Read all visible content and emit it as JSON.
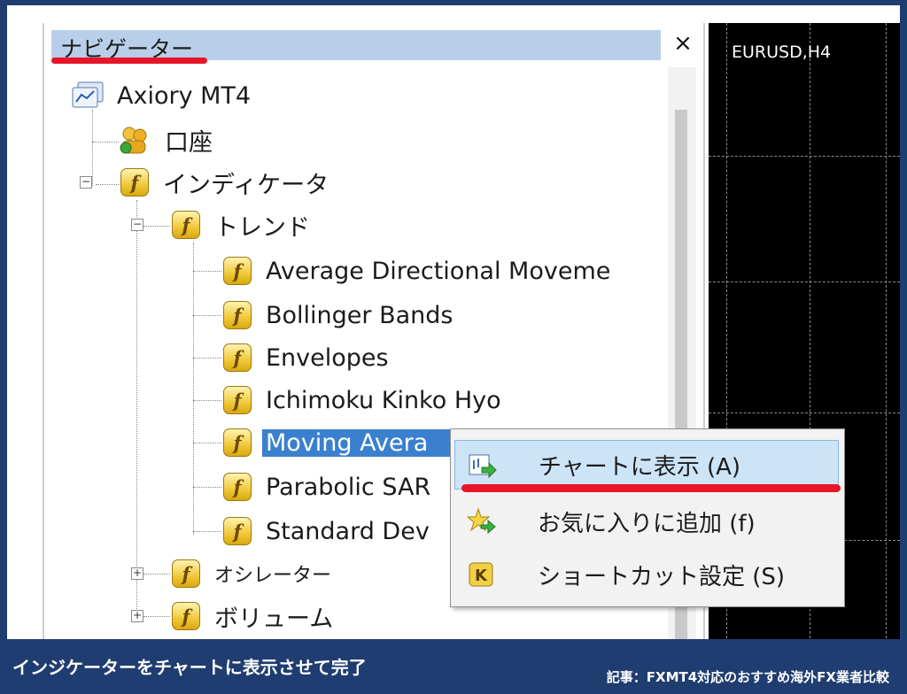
{
  "navigator": {
    "title": "ナビゲーター",
    "close": "×",
    "tree": {
      "root": "Axiory MT4",
      "account": "口座",
      "indicators": "インディケータ",
      "trend": "トレンド",
      "trend_items": [
        "Average Directional Moveme",
        "Bollinger Bands",
        "Envelopes",
        "Ichimoku Kinko Hyo",
        "Moving Avera",
        "Parabolic SAR",
        "Standard Dev"
      ],
      "oscillators": "オシレーター",
      "volumes": "ボリューム"
    }
  },
  "chart": {
    "symbol": "EURUSD,H4"
  },
  "context_menu": {
    "items": [
      {
        "label": "チャートに表示 (A)",
        "icon": "chart-attach-icon"
      },
      {
        "label": "お気に入りに追加 (f)",
        "icon": "favorite-star-icon"
      },
      {
        "label": "ショートカット設定 (S)",
        "icon": "shortcut-k-icon"
      }
    ]
  },
  "caption": {
    "main": "インジケーターをチャートに表示させて完了",
    "credit": "記事：FXMT4対応のおすすめ海外FX業者比較"
  },
  "colors": {
    "accent_red": "#e8152a",
    "selection_blue": "#3a80cf",
    "frame_navy": "#1f3d70"
  }
}
